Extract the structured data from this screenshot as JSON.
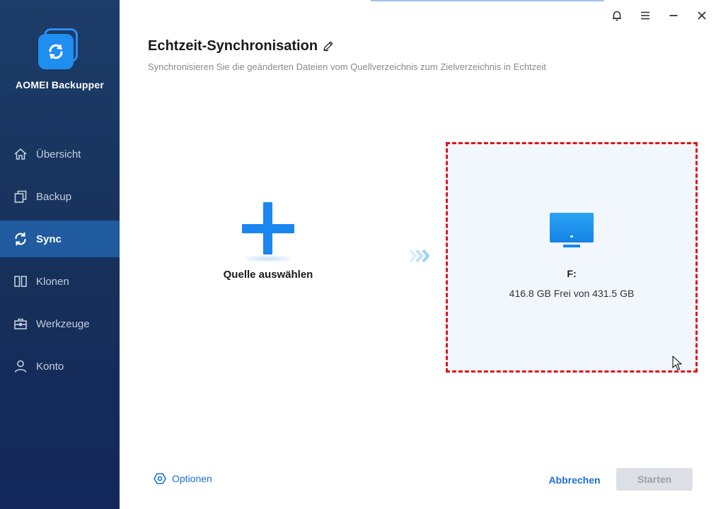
{
  "app": {
    "name": "AOMEI Backupper"
  },
  "sidebar": {
    "items": [
      {
        "label": "Übersicht",
        "icon": "home-icon",
        "active": false
      },
      {
        "label": "Backup",
        "icon": "copy-icon",
        "active": false
      },
      {
        "label": "Sync",
        "icon": "sync-icon",
        "active": true
      },
      {
        "label": "Klonen",
        "icon": "clone-icon",
        "active": false
      },
      {
        "label": "Werkzeuge",
        "icon": "toolbox-icon",
        "active": false
      },
      {
        "label": "Konto",
        "icon": "user-icon",
        "active": false
      }
    ]
  },
  "header": {
    "title": "Echtzeit-Synchronisation",
    "subtitle": "Synchronisieren Sie die geänderten Dateien vom Quellverzeichnis zum Zielverzeichnis in Echtzeit"
  },
  "source": {
    "label": "Quelle auswählen"
  },
  "destination": {
    "drive": "F:",
    "space": "416.8 GB Frei von 431.5 GB"
  },
  "footer": {
    "options_label": "Optionen",
    "cancel_label": "Abbrechen",
    "start_label": "Starten"
  },
  "colors": {
    "accent": "#1a86f0",
    "link": "#1a6fd6",
    "highlight_border": "#e0141b",
    "sidebar_bg": "#16305a",
    "sidebar_active": "#1f5b9e"
  }
}
